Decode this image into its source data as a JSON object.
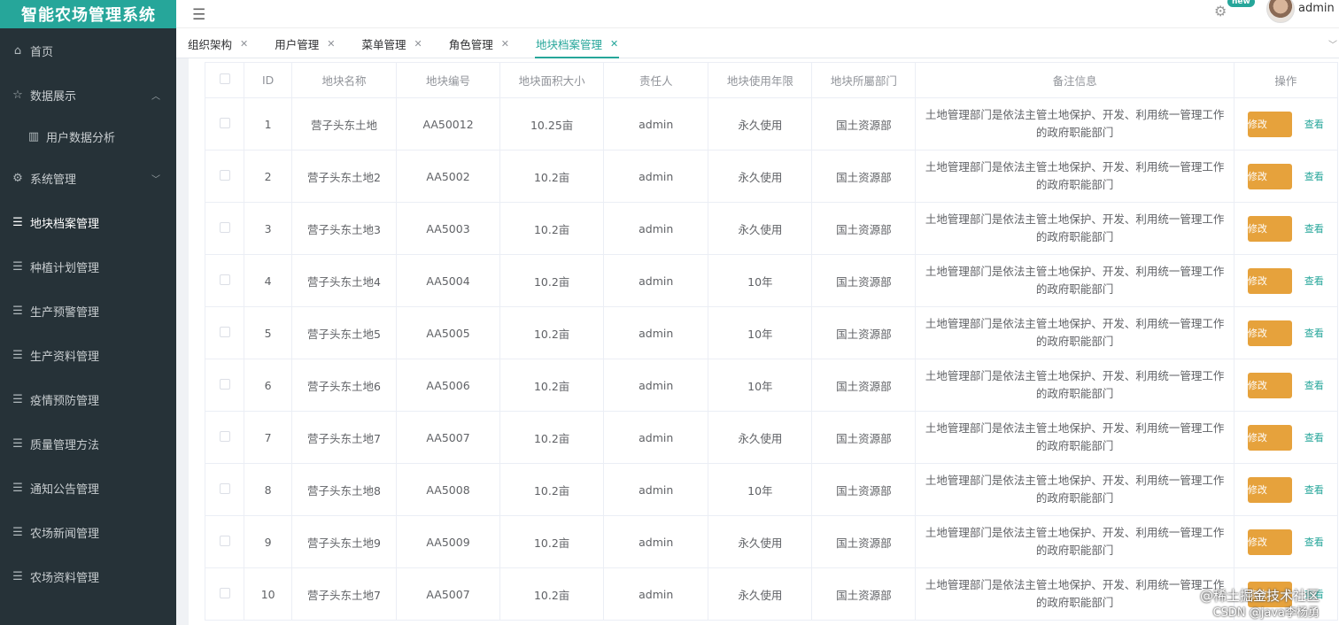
{
  "app": {
    "title": "智能农场管理系统"
  },
  "header": {
    "menu_icon": "hamburger-icon",
    "settings_icon": "gear-icon",
    "badge": "new",
    "username": "admin"
  },
  "sidebar": {
    "items": [
      {
        "label": "首页",
        "icon": "home-icon",
        "glyph": "⌂"
      },
      {
        "label": "数据展示",
        "icon": "star-icon",
        "glyph": "☆",
        "arrow": "︿"
      },
      {
        "label": "用户数据分析",
        "icon": "bar-chart-icon",
        "glyph": "▥"
      },
      {
        "label": "系统管理",
        "icon": "gear-icon",
        "glyph": "⚙",
        "arrow": "﹀"
      },
      {
        "label": "地块档案管理",
        "icon": "list-icon",
        "glyph": "☰"
      },
      {
        "label": "种植计划管理",
        "icon": "list-icon",
        "glyph": "☰"
      },
      {
        "label": "生产预警管理",
        "icon": "list-icon",
        "glyph": "☰"
      },
      {
        "label": "生产资料管理",
        "icon": "list-icon",
        "glyph": "☰"
      },
      {
        "label": "疫情预防管理",
        "icon": "list-icon",
        "glyph": "☰"
      },
      {
        "label": "质量管理方法",
        "icon": "list-icon",
        "glyph": "☰"
      },
      {
        "label": "通知公告管理",
        "icon": "list-icon",
        "glyph": "☰"
      },
      {
        "label": "农场新闻管理",
        "icon": "list-icon",
        "glyph": "☰"
      },
      {
        "label": "农场资料管理",
        "icon": "list-icon",
        "glyph": "☰"
      }
    ]
  },
  "tabs": [
    {
      "label": "组织架构"
    },
    {
      "label": "用户管理"
    },
    {
      "label": "菜单管理"
    },
    {
      "label": "角色管理"
    },
    {
      "label": "地块档案管理",
      "active": true
    }
  ],
  "table": {
    "headers": [
      "ID",
      "地块名称",
      "地块编号",
      "地块面积大小",
      "责任人",
      "地块使用年限",
      "地块所屬部门",
      "备注信息",
      "操作"
    ],
    "edit_label": "修改",
    "view_label": "查看",
    "rows": [
      {
        "id": "1",
        "name": "营子头东土地",
        "code": "AA50012",
        "area": "10.25亩",
        "owner": "admin",
        "years": "永久使用",
        "dept": "国土资源部",
        "note": "土地管理部门是依法主管土地保护、开发、利用统一管理工作的政府职能部门"
      },
      {
        "id": "2",
        "name": "营子头东土地2",
        "code": "AA5002",
        "area": "10.2亩",
        "owner": "admin",
        "years": "永久使用",
        "dept": "国土资源部",
        "note": "土地管理部门是依法主管土地保护、开发、利用统一管理工作的政府职能部门"
      },
      {
        "id": "3",
        "name": "营子头东土地3",
        "code": "AA5003",
        "area": "10.2亩",
        "owner": "admin",
        "years": "永久使用",
        "dept": "国土资源部",
        "note": "土地管理部门是依法主管土地保护、开发、利用统一管理工作的政府职能部门"
      },
      {
        "id": "4",
        "name": "营子头东土地4",
        "code": "AA5004",
        "area": "10.2亩",
        "owner": "admin",
        "years": "10年",
        "dept": "国土资源部",
        "note": "土地管理部门是依法主管土地保护、开发、利用统一管理工作的政府职能部门"
      },
      {
        "id": "5",
        "name": "营子头东土地5",
        "code": "AA5005",
        "area": "10.2亩",
        "owner": "admin",
        "years": "10年",
        "dept": "国土资源部",
        "note": "土地管理部门是依法主管土地保护、开发、利用统一管理工作的政府职能部门"
      },
      {
        "id": "6",
        "name": "营子头东土地6",
        "code": "AA5006",
        "area": "10.2亩",
        "owner": "admin",
        "years": "10年",
        "dept": "国土资源部",
        "note": "土地管理部门是依法主管土地保护、开发、利用统一管理工作的政府职能部门"
      },
      {
        "id": "7",
        "name": "营子头东土地7",
        "code": "AA5007",
        "area": "10.2亩",
        "owner": "admin",
        "years": "永久使用",
        "dept": "国土资源部",
        "note": "土地管理部门是依法主管土地保护、开发、利用统一管理工作的政府职能部门"
      },
      {
        "id": "8",
        "name": "营子头东土地8",
        "code": "AA5008",
        "area": "10.2亩",
        "owner": "admin",
        "years": "10年",
        "dept": "国土资源部",
        "note": "土地管理部门是依法主管土地保护、开发、利用统一管理工作的政府职能部门"
      },
      {
        "id": "9",
        "name": "营子头东土地9",
        "code": "AA5009",
        "area": "10.2亩",
        "owner": "admin",
        "years": "永久使用",
        "dept": "国土资源部",
        "note": "土地管理部门是依法主管土地保护、开发、利用统一管理工作的政府职能部门"
      },
      {
        "id": "10",
        "name": "营子头东土地7",
        "code": "AA5007",
        "area": "10.2亩",
        "owner": "admin",
        "years": "永久使用",
        "dept": "国土资源部",
        "note": "土地管理部门是依法主管土地保护、开发、利用统一管理工作的政府职能部门"
      }
    ]
  },
  "watermark": {
    "line1": "@稀土掘金技术社区",
    "line2": "CSDN @java李杨勇"
  }
}
